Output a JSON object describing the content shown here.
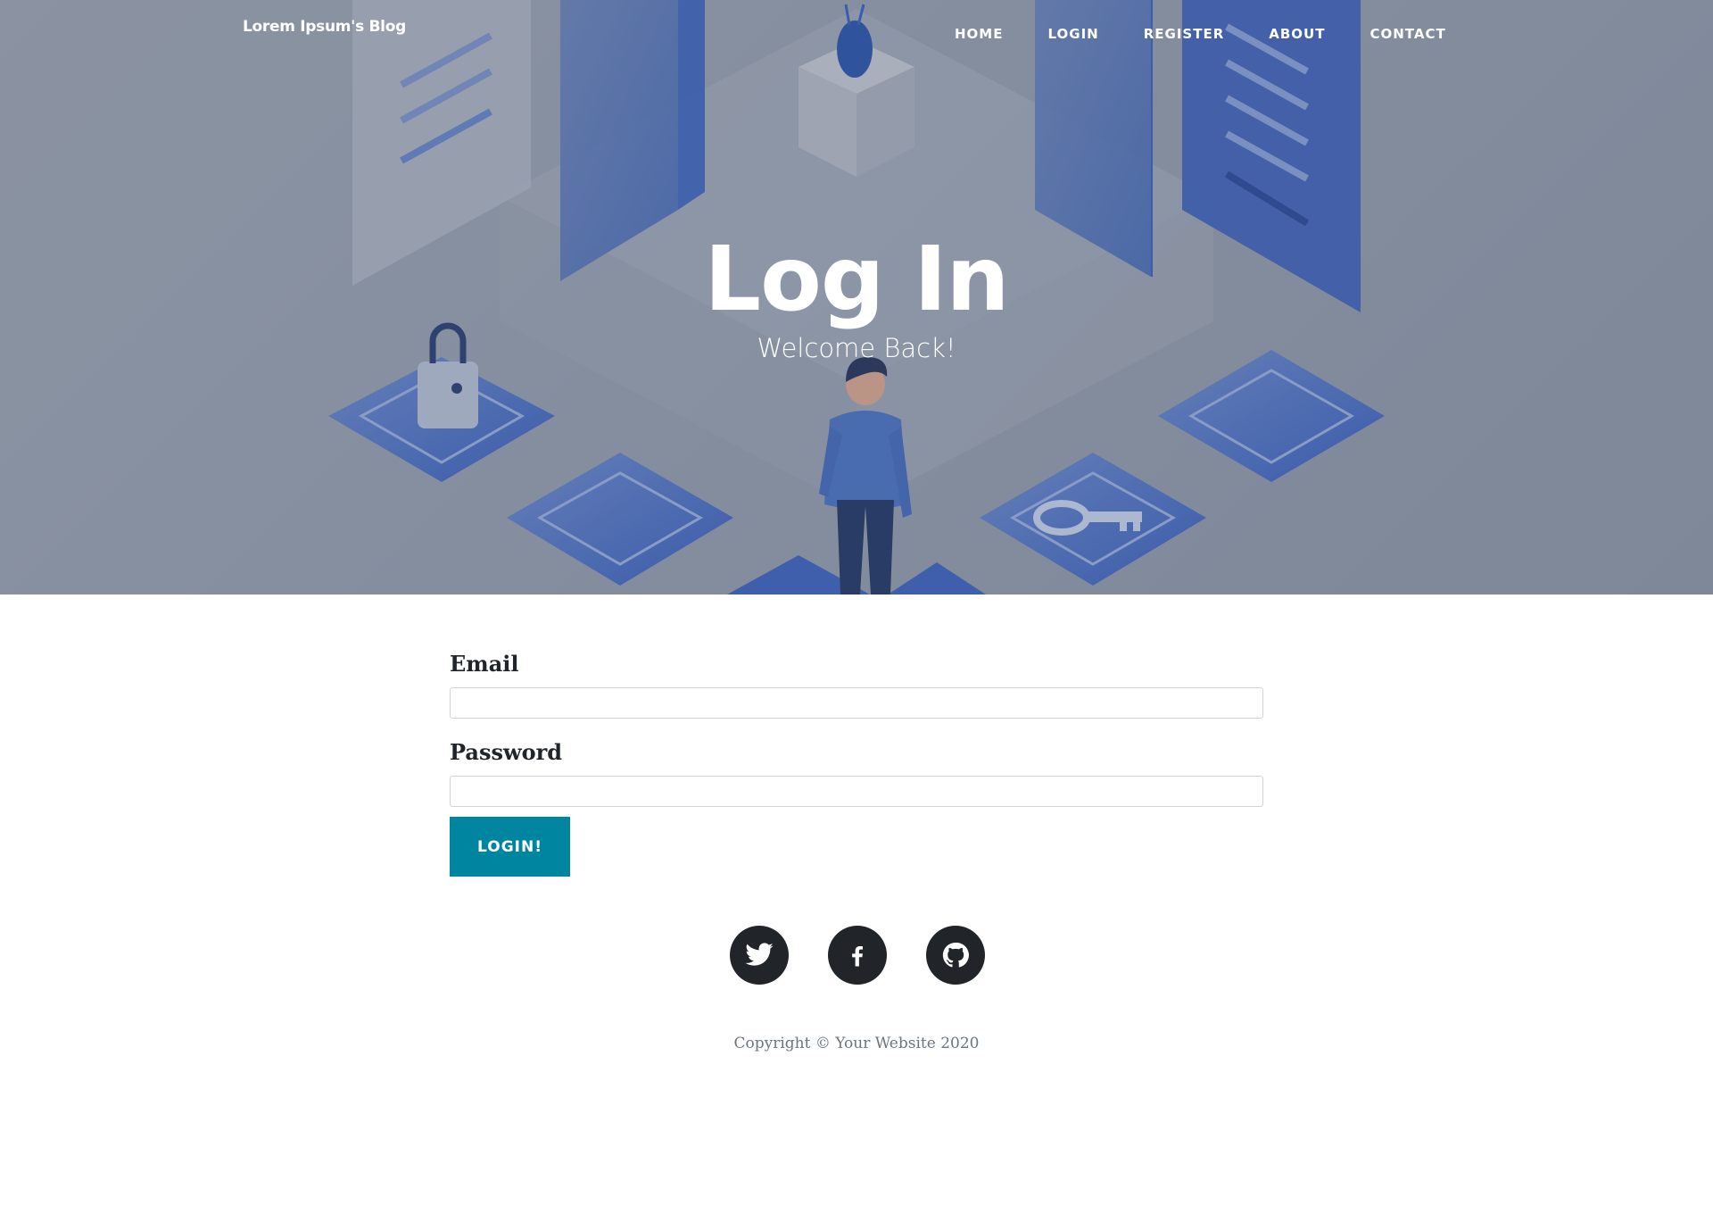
{
  "nav": {
    "brand": "Lorem Ipsum's Blog",
    "items": [
      {
        "label": "HOME"
      },
      {
        "label": "LOGIN"
      },
      {
        "label": "REGISTER"
      },
      {
        "label": "ABOUT"
      },
      {
        "label": "CONTACT"
      }
    ]
  },
  "hero": {
    "title": "Log In",
    "subtitle": "Welcome Back!"
  },
  "form": {
    "email_label": "Email",
    "email_value": "",
    "password_label": "Password",
    "password_value": "",
    "submit_label": "LOGIN!"
  },
  "footer": {
    "social": [
      {
        "icon": "twitter-icon"
      },
      {
        "icon": "facebook-icon"
      },
      {
        "icon": "github-icon"
      }
    ],
    "copyright": "Copyright © Your Website 2020"
  },
  "colors": {
    "accent": "#0085a1",
    "dark": "#212529",
    "muted": "#6c757d",
    "hero_blue": "#2c55b8"
  }
}
